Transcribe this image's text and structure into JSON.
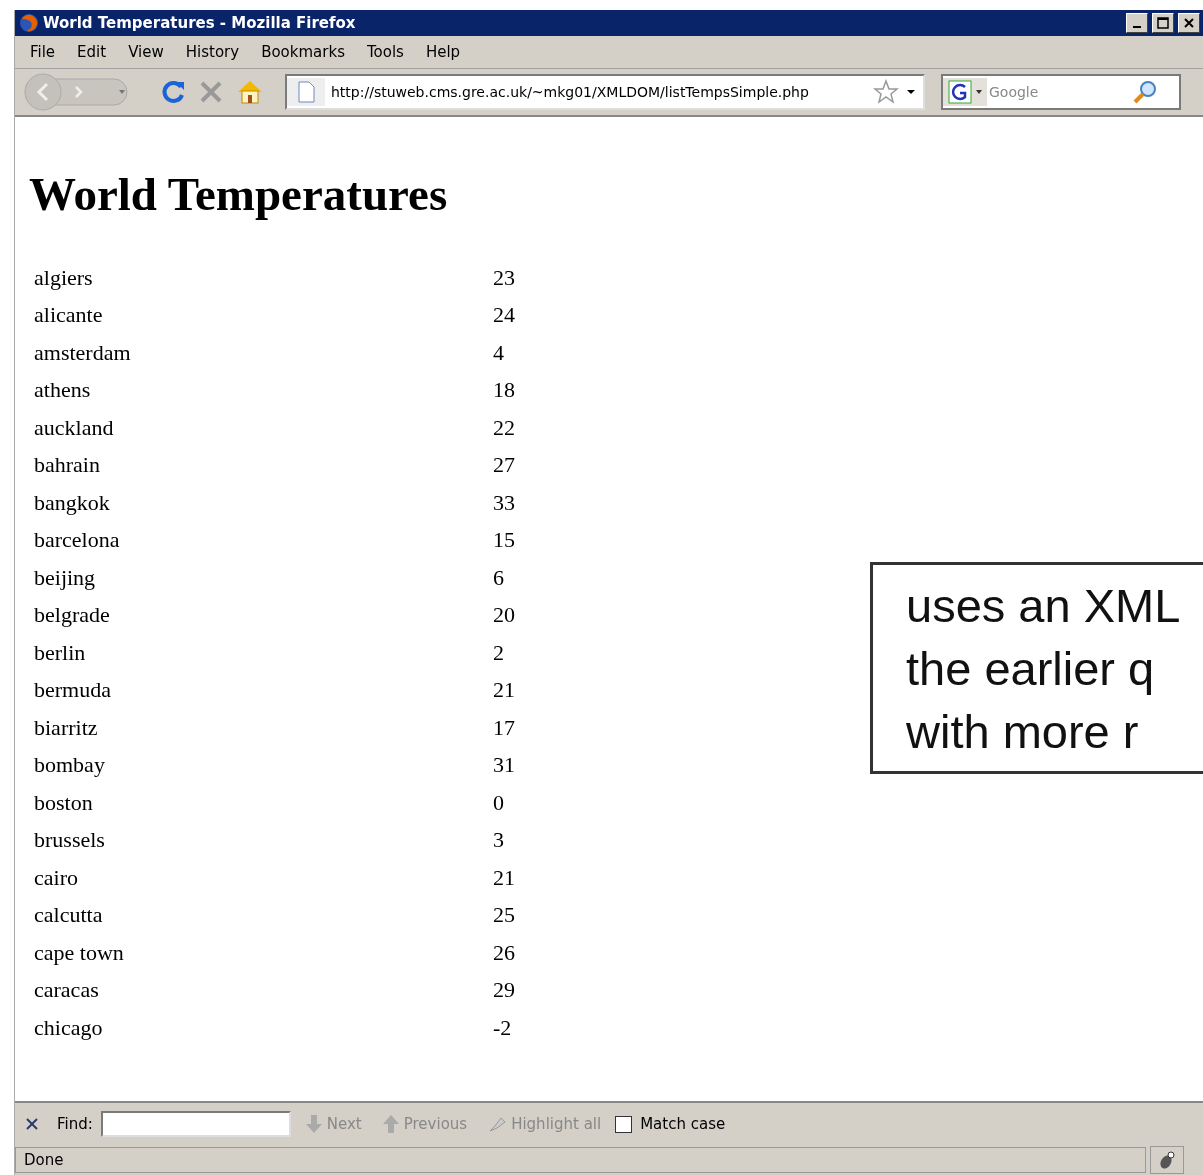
{
  "window": {
    "title": "World Temperatures - Mozilla Firefox"
  },
  "menu": [
    "File",
    "Edit",
    "View",
    "History",
    "Bookmarks",
    "Tools",
    "Help"
  ],
  "address": {
    "value": "http://stuweb.cms.gre.ac.uk/~mkg01/XMLDOM/listTempsSimple.php"
  },
  "search": {
    "placeholder": "Google"
  },
  "page": {
    "heading": "World Temperatures",
    "rows": [
      {
        "city": "algiers",
        "temp": "23"
      },
      {
        "city": "alicante",
        "temp": "24"
      },
      {
        "city": "amsterdam",
        "temp": "4"
      },
      {
        "city": "athens",
        "temp": "18"
      },
      {
        "city": "auckland",
        "temp": "22"
      },
      {
        "city": "bahrain",
        "temp": "27"
      },
      {
        "city": "bangkok",
        "temp": "33"
      },
      {
        "city": "barcelona",
        "temp": "15"
      },
      {
        "city": "beijing",
        "temp": "6"
      },
      {
        "city": "belgrade",
        "temp": "20"
      },
      {
        "city": "berlin",
        "temp": "2"
      },
      {
        "city": "bermuda",
        "temp": "21"
      },
      {
        "city": "biarritz",
        "temp": "17"
      },
      {
        "city": "bombay",
        "temp": "31"
      },
      {
        "city": "boston",
        "temp": "0"
      },
      {
        "city": "brussels",
        "temp": "3"
      },
      {
        "city": "cairo",
        "temp": "21"
      },
      {
        "city": "calcutta",
        "temp": "25"
      },
      {
        "city": "cape town",
        "temp": "26"
      },
      {
        "city": "caracas",
        "temp": "29"
      },
      {
        "city": "chicago",
        "temp": "-2"
      }
    ]
  },
  "callout": {
    "lines": [
      "uses an XML",
      "the earlier q",
      "with more r"
    ]
  },
  "find_bar": {
    "label": "Find:",
    "next": "Next",
    "previous": "Previous",
    "highlight": "Highlight all",
    "match_case": {
      "label": "Match case",
      "checked": false
    }
  },
  "status_bar": {
    "text": "Done"
  }
}
